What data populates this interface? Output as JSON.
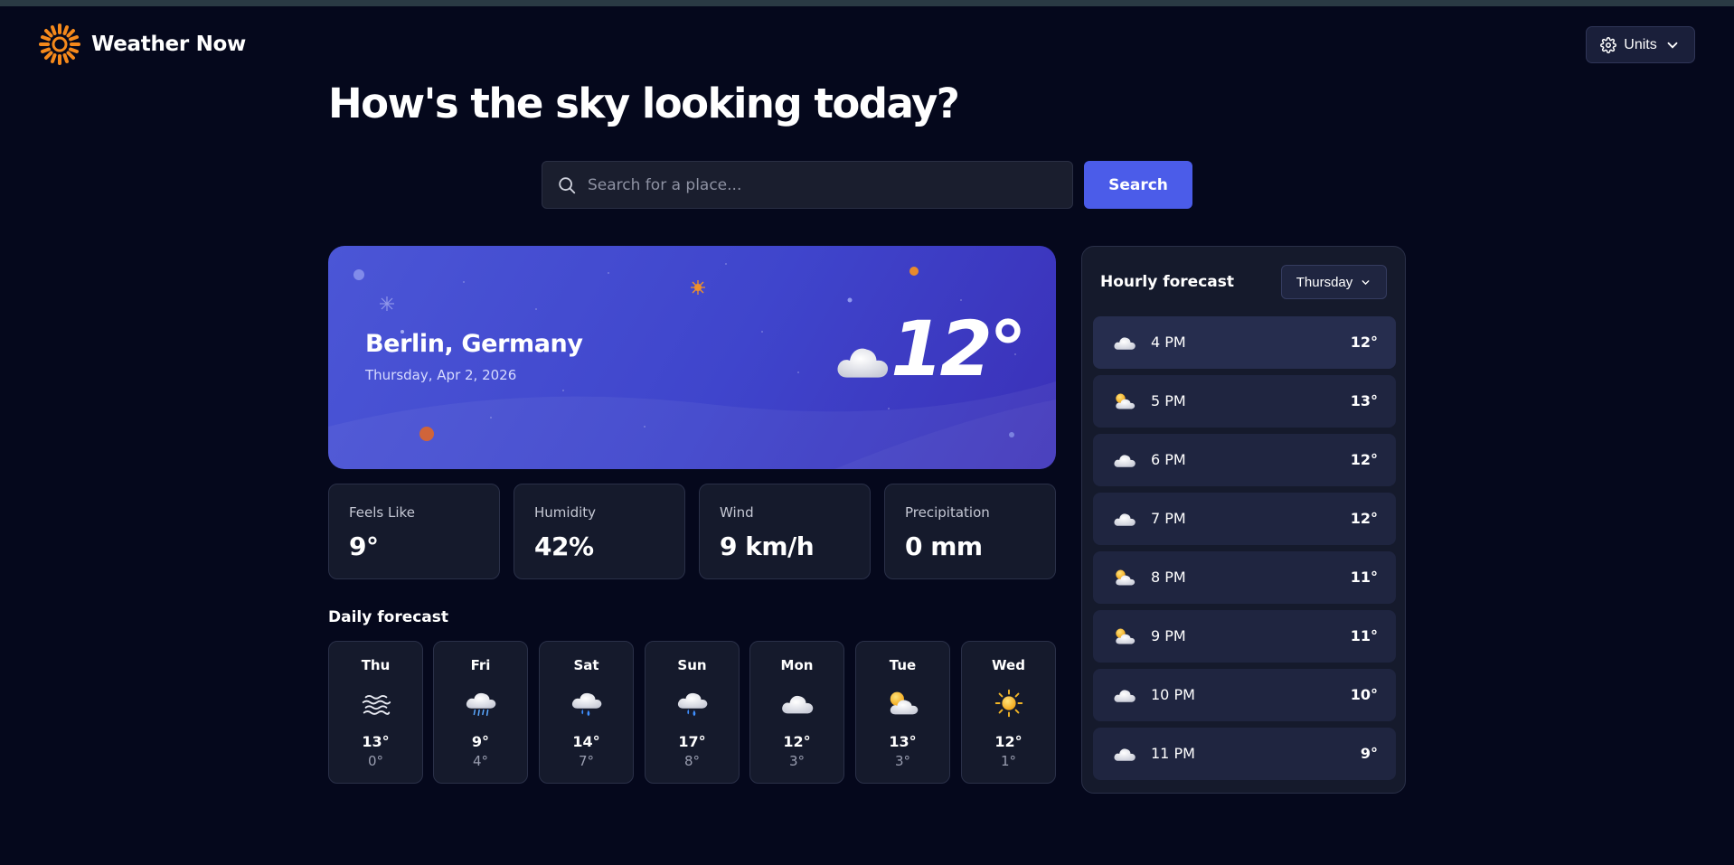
{
  "app": {
    "name": "Weather Now",
    "logo_icon": "sun-logo-icon",
    "accent": "#f5891b"
  },
  "header": {
    "units_label": "Units",
    "units_icon": "gear-icon",
    "chevron_icon": "chevron-down-icon"
  },
  "headline": "How's the sky looking today?",
  "search": {
    "placeholder": "Search for a place...",
    "value": "",
    "button_label": "Search",
    "button_color": "#4b5ce9"
  },
  "current": {
    "city": "Berlin, Germany",
    "date": "Thursday, Apr 2, 2026",
    "temperature": "12°",
    "icon": "cloud-icon"
  },
  "stats": [
    {
      "label": "Feels Like",
      "value": "9°"
    },
    {
      "label": "Humidity",
      "value": "42%"
    },
    {
      "label": "Wind",
      "value": "9 km/h"
    },
    {
      "label": "Precipitation",
      "value": "0 mm"
    }
  ],
  "daily": {
    "title": "Daily forecast",
    "days": [
      {
        "day": "Thu",
        "icon": "fog-icon",
        "high": "13°",
        "low": "0°"
      },
      {
        "day": "Fri",
        "icon": "drizzle-icon",
        "high": "9°",
        "low": "4°"
      },
      {
        "day": "Sat",
        "icon": "rain-icon",
        "high": "14°",
        "low": "7°"
      },
      {
        "day": "Sun",
        "icon": "rain-icon",
        "high": "17°",
        "low": "8°"
      },
      {
        "day": "Mon",
        "icon": "cloud-icon",
        "high": "12°",
        "low": "3°"
      },
      {
        "day": "Tue",
        "icon": "partly-cloudy-icon",
        "high": "13°",
        "low": "3°"
      },
      {
        "day": "Wed",
        "icon": "sun-icon",
        "high": "12°",
        "low": "1°"
      }
    ]
  },
  "hourly": {
    "title": "Hourly forecast",
    "selected_day": "Thursday",
    "hours": [
      {
        "time": "4 PM",
        "icon": "cloud-icon",
        "temp": "12°"
      },
      {
        "time": "5 PM",
        "icon": "partly-cloudy-icon",
        "temp": "13°"
      },
      {
        "time": "6 PM",
        "icon": "cloud-icon",
        "temp": "12°"
      },
      {
        "time": "7 PM",
        "icon": "cloud-icon",
        "temp": "12°"
      },
      {
        "time": "8 PM",
        "icon": "partly-cloudy-icon",
        "temp": "11°"
      },
      {
        "time": "9 PM",
        "icon": "partly-cloudy-icon",
        "temp": "11°"
      },
      {
        "time": "10 PM",
        "icon": "cloud-icon",
        "temp": "10°"
      },
      {
        "time": "11 PM",
        "icon": "cloud-icon",
        "temp": "9°"
      }
    ]
  }
}
